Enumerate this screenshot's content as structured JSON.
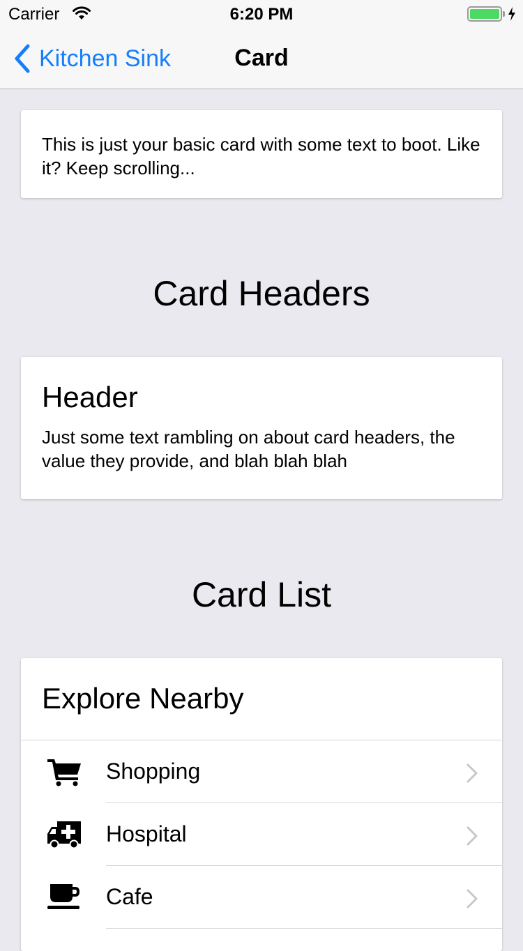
{
  "status_bar": {
    "carrier": "Carrier",
    "time": "6:20 PM",
    "battery_color": "#4cd964"
  },
  "nav": {
    "back_label": "Kitchen Sink",
    "title": "Card",
    "accent_color": "#147efb"
  },
  "basic_card": {
    "text": "This is just your basic card with some text to boot. Like it? Keep scrolling..."
  },
  "headers_section": {
    "title": "Card Headers",
    "card": {
      "header": "Header",
      "text": "Just some text rambling on about card headers, the value they provide, and blah blah blah"
    }
  },
  "list_section": {
    "title": "Card List",
    "card": {
      "header": "Explore Nearby",
      "items": [
        {
          "label": "Shopping",
          "icon": "cart-icon"
        },
        {
          "label": "Hospital",
          "icon": "ambulance-icon"
        },
        {
          "label": "Cafe",
          "icon": "coffee-cup-icon"
        }
      ]
    }
  }
}
